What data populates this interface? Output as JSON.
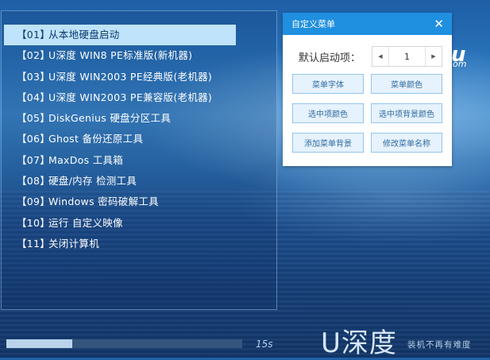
{
  "menu": {
    "items": [
      {
        "num": "【01】",
        "label": "从本地硬盘启动"
      },
      {
        "num": "【02】",
        "label": "U深度 WIN8 PE标准版(新机器)"
      },
      {
        "num": "【03】",
        "label": "U深度 WIN2003 PE经典版(老机器)"
      },
      {
        "num": "【04】",
        "label": "U深度 WIN2003 PE兼容版(老机器)"
      },
      {
        "num": "【05】",
        "label": "DiskGenius 硬盘分区工具"
      },
      {
        "num": "【06】",
        "label": "Ghost 备份还原工具"
      },
      {
        "num": "【07】",
        "label": "MaxDos 工具箱"
      },
      {
        "num": "【08】",
        "label": "硬盘/内存 检测工具"
      },
      {
        "num": "【09】",
        "label": "Windows 密码破解工具"
      },
      {
        "num": "【10】",
        "label": "运行 自定义映像"
      },
      {
        "num": "【11】",
        "label": "关闭计算机"
      }
    ],
    "selected_index": 0
  },
  "dialog": {
    "title": "自定义菜单",
    "close": "✕",
    "default_label": "默认启动项：",
    "stepper": {
      "left": "◀",
      "value": "1",
      "right": "▶"
    },
    "buttons": {
      "menu_font": "菜单字体",
      "menu_color": "菜单颜色",
      "selected_color": "选中项颜色",
      "selected_bg_color": "选中项背景颜色",
      "add_menu_bg": "添加菜单背景",
      "rename_menu": "修改菜单名称"
    }
  },
  "footer": {
    "progress": 0.28,
    "countdown": "15s",
    "brand": "U深度",
    "slogan": "装机不再有难度"
  },
  "logo_fragment": {
    "main": "u",
    "sub": "om"
  },
  "colors": {
    "dialog_header": "#1f8fe0",
    "selected_bg": "#bfe3fb",
    "button_border": "#93c4ee"
  }
}
